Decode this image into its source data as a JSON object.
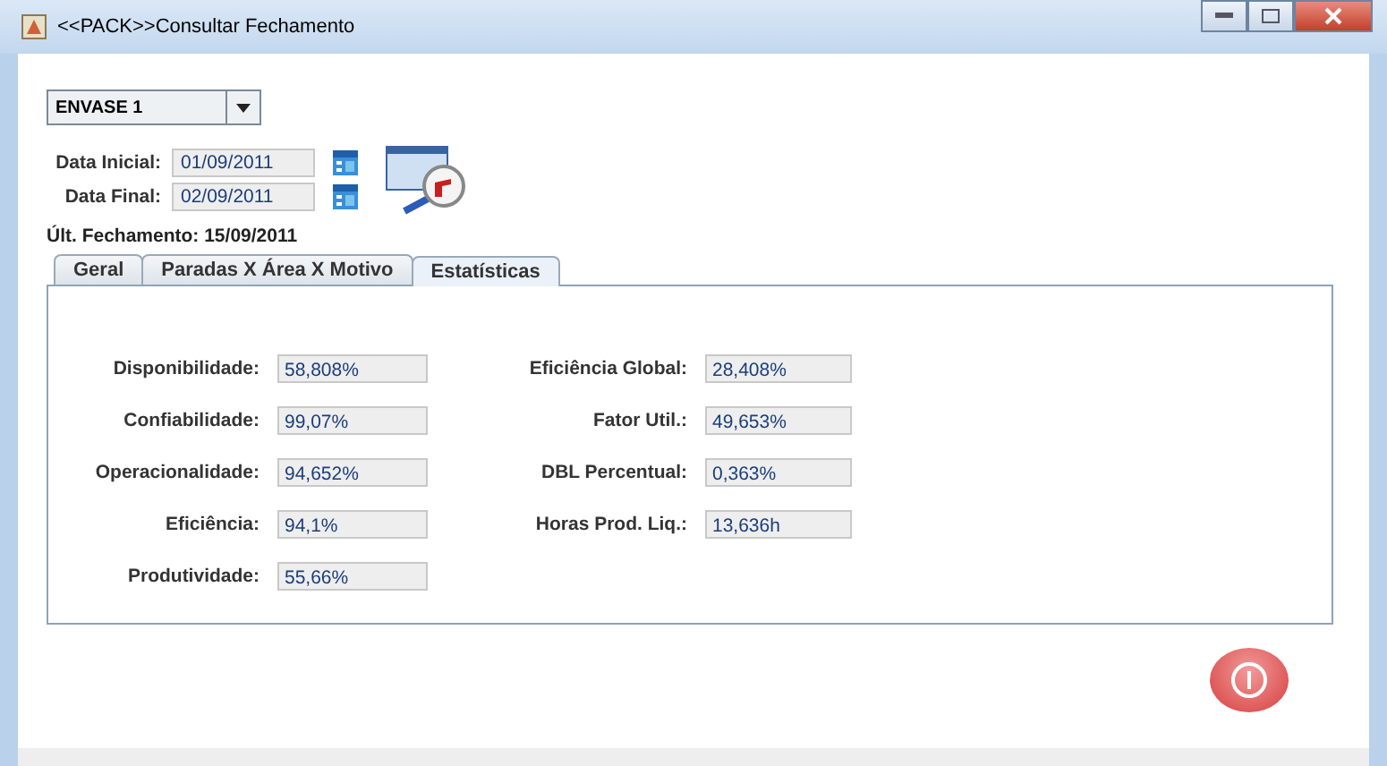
{
  "window": {
    "title": "<<PACK>>Consultar Fechamento"
  },
  "line_select": {
    "value": "ENVASE 1"
  },
  "dates": [
    {
      "label": "Data Inicial:",
      "value": "01/09/2011"
    },
    {
      "label": "Data Final:",
      "value": "02/09/2011"
    }
  ],
  "last_closing": "Últ. Fechamento: 15/09/2011",
  "tabs": [
    {
      "label": "Geral",
      "selected": false
    },
    {
      "label": "Paradas X Área X Motivo",
      "selected": false
    },
    {
      "label": "Estatísticas",
      "selected": true
    }
  ],
  "stats_left": [
    {
      "label": "Disponibilidade:",
      "value": "58,808%"
    },
    {
      "label": "Confiabilidade:",
      "value": "99,07%"
    },
    {
      "label": "Operacionalidade:",
      "value": "94,652%"
    },
    {
      "label": "Eficiência:",
      "value": "94,1%"
    },
    {
      "label": "Produtividade:",
      "value": "55,66%"
    }
  ],
  "stats_right": [
    {
      "label": "Eficiência Global:",
      "value": "28,408%"
    },
    {
      "label": "Fator Util.:",
      "value": "49,653%"
    },
    {
      "label": "DBL Percentual:",
      "value": "0,363%"
    },
    {
      "label": "Horas Prod. Liq.:",
      "value": "13,636h"
    }
  ]
}
